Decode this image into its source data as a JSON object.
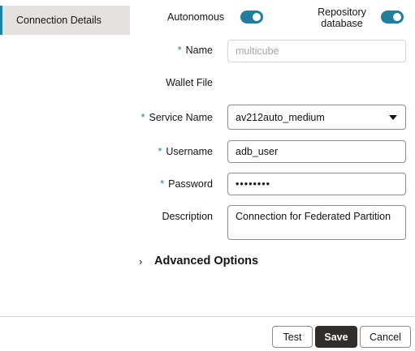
{
  "sidebar": {
    "items": [
      {
        "label": "Connection Details"
      }
    ]
  },
  "toggles": {
    "autonomous": {
      "label": "Autonomous",
      "on": true
    },
    "repository": {
      "label_line1": "Repository",
      "label_line2": "database",
      "on": true
    }
  },
  "form": {
    "name": {
      "label": "Name",
      "placeholder": "multicube",
      "required": true
    },
    "wallet": {
      "label": "Wallet File"
    },
    "service_name": {
      "label": "Service Name",
      "value": "av212auto_medium",
      "required": true
    },
    "username": {
      "label": "Username",
      "value": "adb_user",
      "required": true
    },
    "password": {
      "label": "Password",
      "value": "••••••••",
      "required": true
    },
    "description": {
      "label": "Description",
      "value": "Connection for Federated Partition"
    },
    "required_marker": "*"
  },
  "advanced": {
    "label": "Advanced Options",
    "chevron": "›"
  },
  "footer": {
    "test_label": "Test",
    "save_label": "Save",
    "cancel_label": "Cancel"
  },
  "colors": {
    "accent": "#227e9e",
    "primary_button": "#312d2a",
    "sidebar_selected": "#e4e2df"
  }
}
